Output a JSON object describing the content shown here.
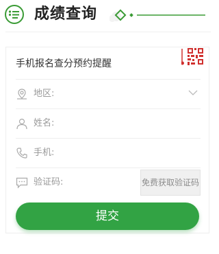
{
  "header": {
    "title": "成绩查询",
    "icon": "list-icon",
    "accent_color": "#3a9b35"
  },
  "form": {
    "title": "手机报名查分预约提醒",
    "qr_icon": "qr-code-icon",
    "fields": [
      {
        "icon": "location-icon",
        "label": "地区:",
        "type": "select"
      },
      {
        "icon": "user-icon",
        "label": "姓名:",
        "type": "text"
      },
      {
        "icon": "phone-icon",
        "label": "手机:",
        "type": "text"
      },
      {
        "icon": "chat-icon",
        "label": "验证码:",
        "type": "text"
      }
    ],
    "get_code_label": "免费获取验证码",
    "submit_label": "提交",
    "submit_color": "#32a344"
  }
}
